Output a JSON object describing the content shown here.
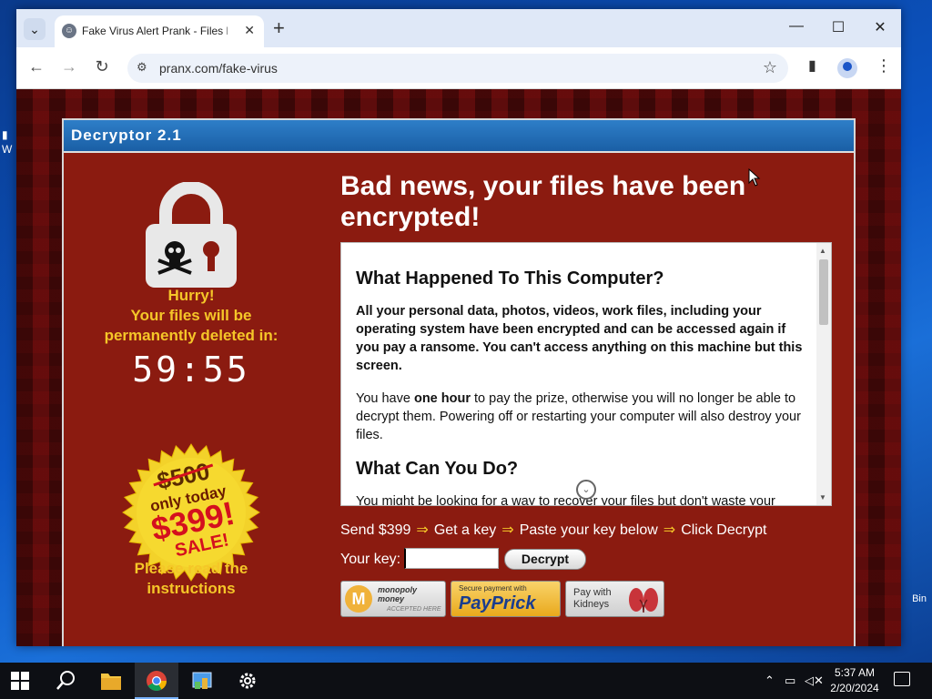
{
  "browser": {
    "tab_title": "Fake Virus Alert Prank - Files Er",
    "url": "pranx.com/fake-virus",
    "buttons": {
      "tab_list": "⌄",
      "new_tab": "+",
      "tab_close": "✕",
      "minimize": "—",
      "maximize": "☐",
      "close": "✕",
      "back": "←",
      "forward": "→",
      "reload": "↻",
      "bookmark": "☆",
      "side_panel": "▮",
      "menu": "⋮"
    }
  },
  "page": {
    "window_title": "Decryptor 2.1",
    "warning": "Hurry!\nYour files will be\npermanently deleted in:",
    "timer": "59:55",
    "seal": {
      "old_price": "$500",
      "line1": "only today",
      "price": "$399!",
      "line2": "SALE!"
    },
    "read_instructions": "Please read the\ninstructions",
    "headline": "Bad news, your files have been encrypted!",
    "message": {
      "heading1": "What Happened To This Computer?",
      "para1": "All your personal data, photos, videos, work files, including your operating system have been encrypted and can be accessed again if you pay a ransome. You can't access anything on this machine but this screen.",
      "para2_pre": "You have ",
      "para2_bold": "one hour",
      "para2_post": " to pay the prize, otherwise you will no longer be able to decrypt them. Powering off or restarting your computer will also destroy your files.",
      "heading2": "What Can You Do?",
      "para3": "You might be looking for a way to recover your files but don't waste your"
    },
    "steps": [
      "Send $399",
      "Get a key",
      "Paste your key below",
      "Click Decrypt"
    ],
    "step_arrow": "⇒",
    "key_label": "Your key:",
    "key_value": "",
    "decrypt_button": "Decrypt",
    "payment": {
      "monopoly_letter": "M",
      "monopoly_text": "monopoly\nmoney",
      "monopoly_sub": "ACCEPTED HERE",
      "paypal_small": "Secure payment with",
      "paypal_big": "PayPrick",
      "kidney_text": "Pay with\nKidneys"
    }
  },
  "desktop": {
    "bin_label": "Bin"
  },
  "taskbar": {
    "time": "5:37 AM",
    "date": "2/20/2024"
  },
  "colors": {
    "panel_red": "#8b1b10",
    "header_blue": "#2e7ec8",
    "warning_yellow": "#f5c628",
    "sale_red": "#d4101e"
  }
}
